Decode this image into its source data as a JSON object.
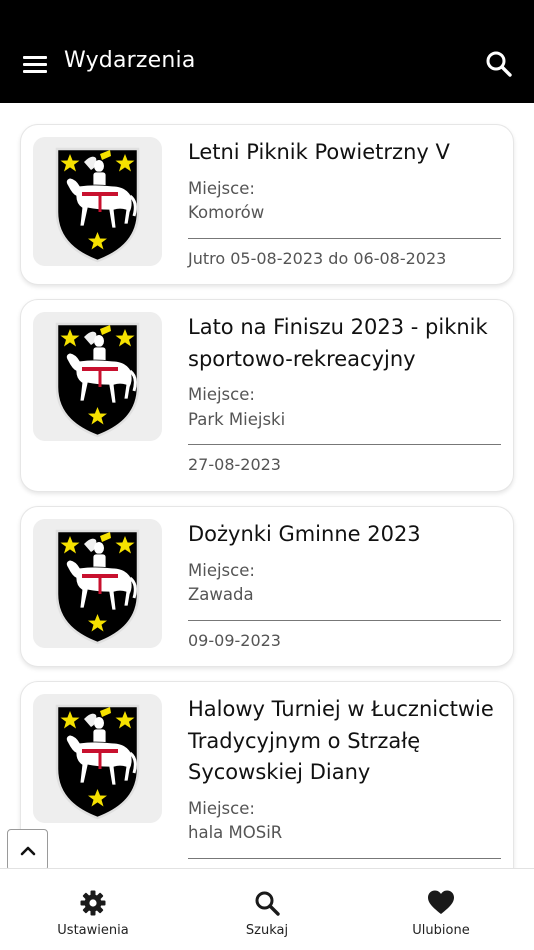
{
  "header": {
    "title": "Wydarzenia",
    "menu_icon": "hamburger-menu-icon",
    "search_icon": "search-icon"
  },
  "events": [
    {
      "title": "Letni Piknik Powietrzny V",
      "place_label": "Miejsce:",
      "place": "Komorów",
      "date": "Jutro 05-08-2023 do 06-08-2023"
    },
    {
      "title": "Lato na Finiszu 2023 - piknik sportowo-rekreacyjny",
      "place_label": "Miejsce:",
      "place": "Park Miejski",
      "date": "27-08-2023"
    },
    {
      "title": "Dożynki Gminne 2023",
      "place_label": "Miejsce:",
      "place": "Zawada",
      "date": "09-09-2023"
    },
    {
      "title": "Halowy Turniej w Łucznictwie Tradycyjnym o Strzałę Sycowskiej Diany",
      "place_label": "Miejsce:",
      "place": "hala MOSiR",
      "date": ""
    }
  ],
  "scroll_top_icon": "chevron-up-icon",
  "bottom_nav": [
    {
      "label": "Ustawienia",
      "icon": "gear-icon"
    },
    {
      "label": "Szukaj",
      "icon": "search-icon"
    },
    {
      "label": "Ulubione",
      "icon": "heart-icon"
    }
  ],
  "colors": {
    "header_bg": "#000000",
    "header_text": "#ffffff",
    "coat_shield": "#000000",
    "coat_stars": "#f5e100",
    "coat_horse": "#ffffff",
    "coat_saddle": "#c8102e"
  }
}
